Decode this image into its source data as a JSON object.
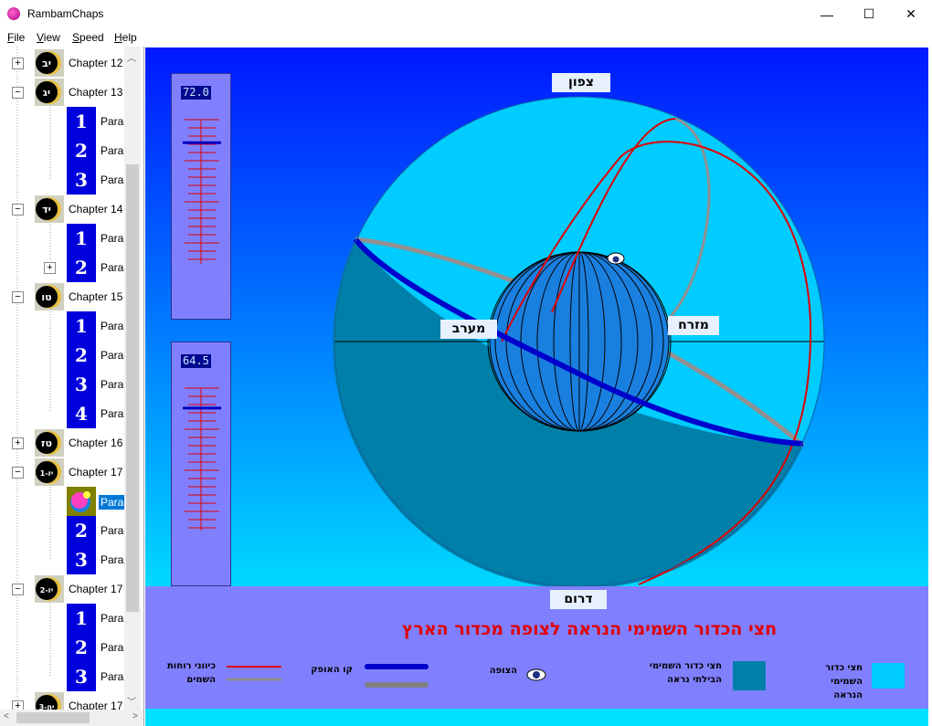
{
  "window": {
    "title": "RambamChaps",
    "minimize": "—",
    "maximize": "☐",
    "close": "✕"
  },
  "menu": [
    "File",
    "View",
    "Speed",
    "Help"
  ],
  "tree": {
    "chapters": [
      {
        "badge": "יב",
        "label": "Chapter 12"
      },
      {
        "badge": "יג",
        "label": "Chapter 13"
      },
      {
        "badge": "יד",
        "label": "Chapter 14"
      },
      {
        "badge": "טו",
        "label": "Chapter 15"
      },
      {
        "badge": "טז",
        "label": "Chapter 16"
      },
      {
        "badge": "יז-1",
        "label": "Chapter 17"
      },
      {
        "badge": "יז-2",
        "label": "Chapter 17"
      },
      {
        "badge": "יח-3",
        "label": "Chapter 17"
      }
    ],
    "paragraph_label": "Paragraph",
    "numbers": [
      "1",
      "2",
      "3",
      "4"
    ]
  },
  "sliders": [
    {
      "value": "72.0",
      "level": 0.16
    },
    {
      "value": "64.5",
      "level": 0.14
    }
  ],
  "directions": {
    "north": "צפון",
    "south": "דרום",
    "east": "מזרח",
    "west": "מערב"
  },
  "caption": "חצי הכדור השמימי הנראה לצופה מכדור הארץ",
  "legend": {
    "visible_half": "חצי כדור השמימי הנראה",
    "invisible_half": "חצי כדור השמימי הבילתי נראה",
    "observer": "הצופה",
    "horizon": "קו האופק",
    "directions_lines": "כיווני רוחות השמים"
  },
  "colors": {
    "visible": "#00ccff",
    "invisible": "#0080a8",
    "horizon": "#0000cc",
    "meridian": "#e00000",
    "gray_circle": "#909090"
  }
}
